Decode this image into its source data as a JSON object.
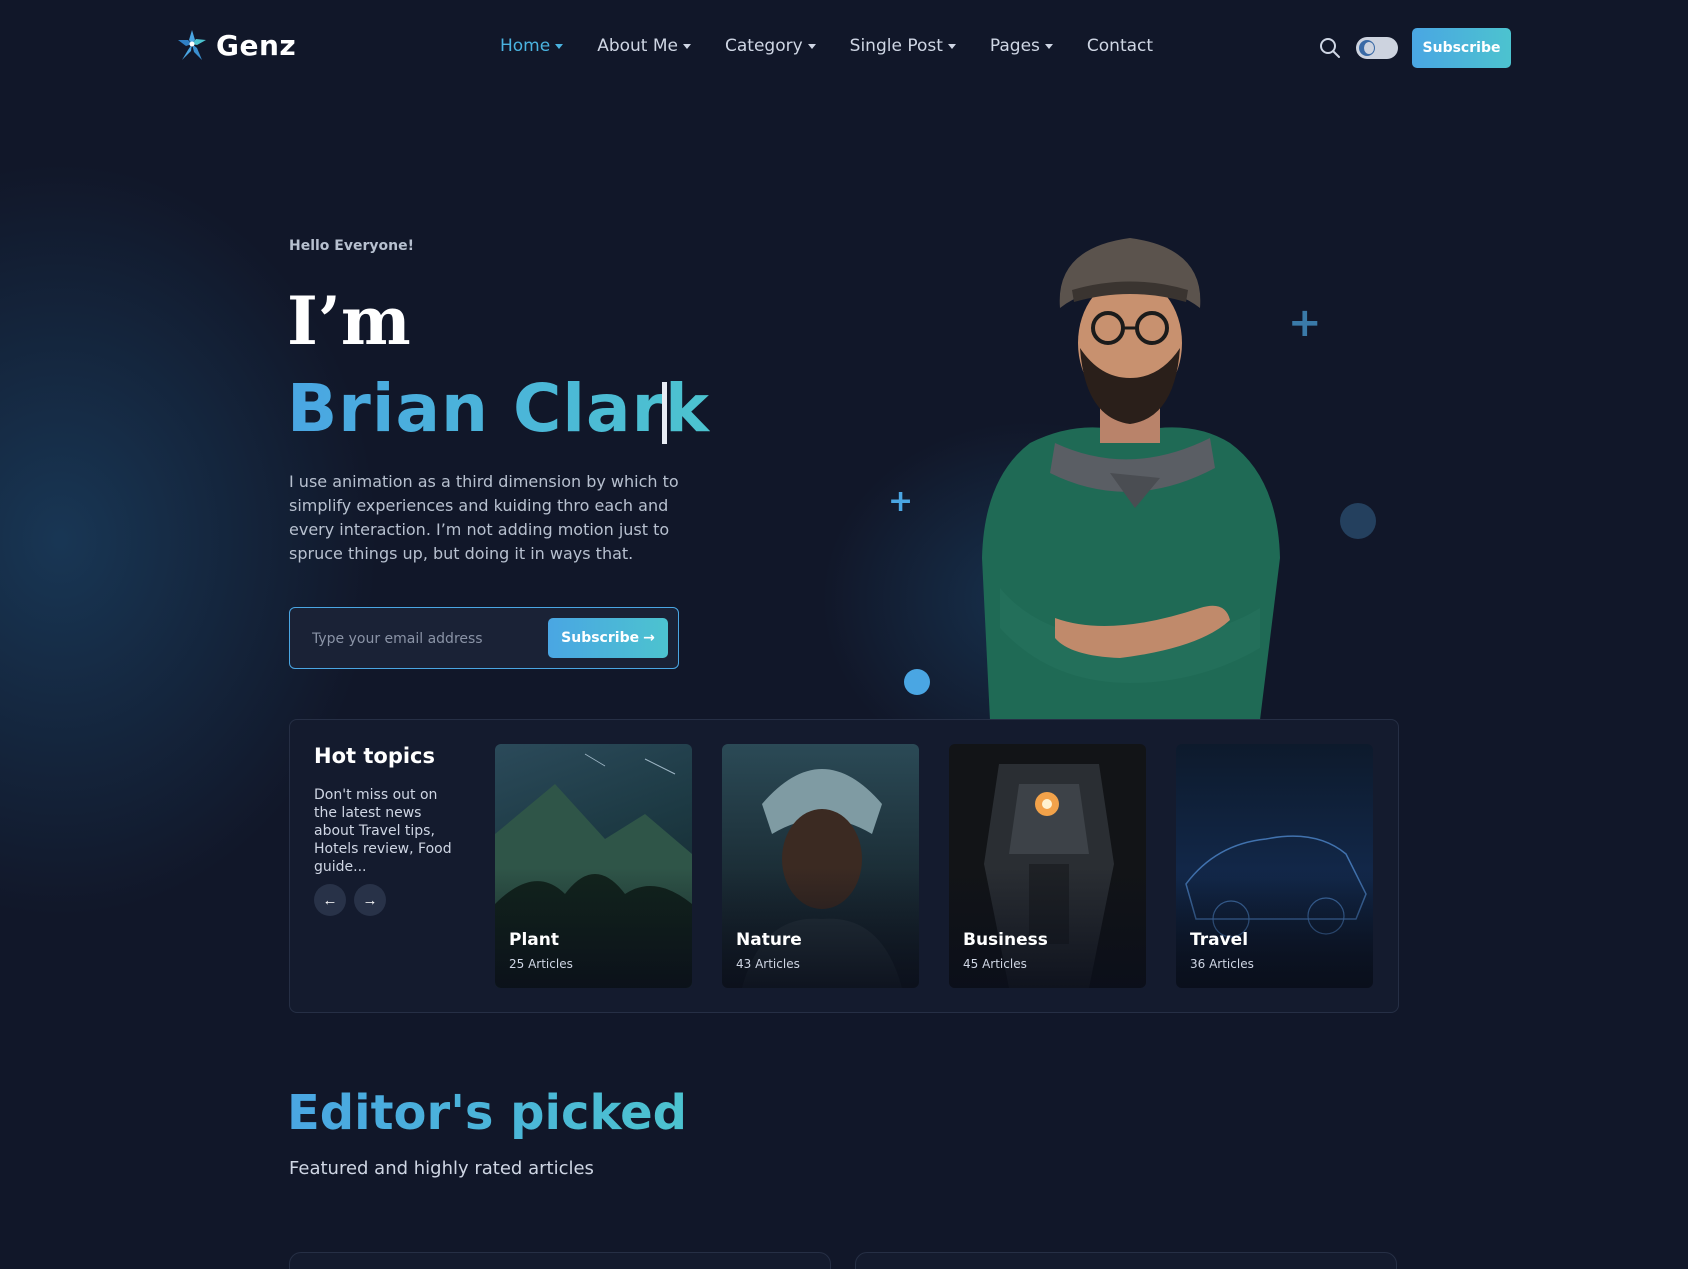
{
  "brand": {
    "name": "Genz",
    "logo_icon": "star-logo-icon"
  },
  "nav": [
    {
      "label": "Home",
      "has_caret": true,
      "active": true
    },
    {
      "label": "About Me",
      "has_caret": true
    },
    {
      "label": "Category",
      "has_caret": true
    },
    {
      "label": "Single Post",
      "has_caret": true
    },
    {
      "label": "Pages",
      "has_caret": true
    },
    {
      "label": "Contact",
      "has_caret": false
    }
  ],
  "header_actions": {
    "search_icon": "search-icon",
    "theme_toggle": "moon-toggle",
    "subscribe_label": "Subscribe"
  },
  "hero": {
    "greeting": "Hello Everyone!",
    "intro": "I’m",
    "name": "Brian Clark",
    "description": "I use animation as a third dimension by which to simplify experiences and kuiding thro each and every interaction. I’m not adding motion just to spruce things up, but doing it in ways that.",
    "email_placeholder": "Type your email address",
    "email_value": "",
    "subscribe_label": "Subscribe"
  },
  "hot_topics": {
    "title": "Hot topics",
    "description": "Don't miss out on the latest news about Travel tips, Hotels review, Food guide...",
    "prev_icon": "arrow-left-icon",
    "next_icon": "arrow-right-icon",
    "cards": [
      {
        "title": "Plant",
        "count": "25 Articles"
      },
      {
        "title": "Nature",
        "count": "43 Articles"
      },
      {
        "title": "Business",
        "count": "45 Articles"
      },
      {
        "title": "Travel",
        "count": "36 Articles"
      }
    ]
  },
  "editors_picked": {
    "title": "Editor's picked",
    "subtitle": "Featured and highly rated articles"
  },
  "colors": {
    "background": "#111729",
    "accent_start": "#4aa6e3",
    "accent_end": "#4cc3cf",
    "panel": "#141b2e",
    "muted_text": "#b7c0cf"
  }
}
